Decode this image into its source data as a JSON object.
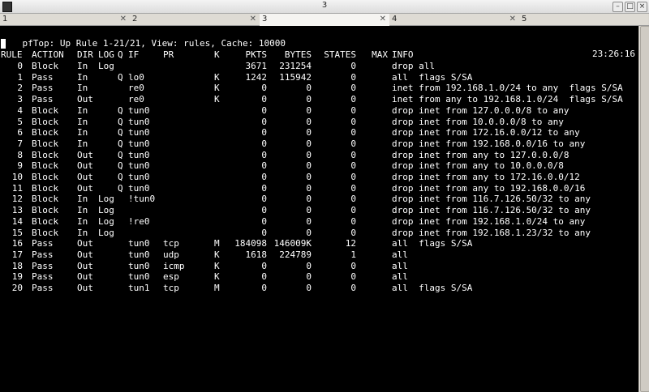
{
  "window": {
    "title": "3"
  },
  "tabs": [
    {
      "label": "1"
    },
    {
      "label": "2"
    },
    {
      "label": "3"
    },
    {
      "label": "4"
    },
    {
      "label": "5"
    }
  ],
  "status": {
    "left": "pfTop: Up Rule 1-21/21, View: rules, Cache: 10000",
    "clock": "23:26:16"
  },
  "headers": {
    "rule": "RULE",
    "action": "ACTION",
    "dir": "DIR",
    "log": "LOG",
    "q": "Q",
    "if": "IF",
    "pr": "PR",
    "k": "K",
    "pkts": "PKTS",
    "bytes": "BYTES",
    "states": "STATES",
    "max": "MAX",
    "info": "INFO"
  },
  "rows": [
    {
      "rule": "0",
      "action": "Block",
      "dir": "In",
      "log": "Log",
      "q": "",
      "if": "",
      "pr": "",
      "k": "",
      "pkts": "3671",
      "bytes": "231254",
      "states": "0",
      "max": "",
      "info": "drop all"
    },
    {
      "rule": "1",
      "action": "Pass",
      "dir": "In",
      "log": "",
      "q": "Q",
      "if": "lo0",
      "pr": "",
      "k": "K",
      "pkts": "1242",
      "bytes": "115942",
      "states": "0",
      "max": "",
      "info": "all  flags S/SA"
    },
    {
      "rule": "2",
      "action": "Pass",
      "dir": "In",
      "log": "",
      "q": "",
      "if": "re0",
      "pr": "",
      "k": "K",
      "pkts": "0",
      "bytes": "0",
      "states": "0",
      "max": "",
      "info": "inet from 192.168.1.0/24 to any  flags S/SA"
    },
    {
      "rule": "3",
      "action": "Pass",
      "dir": "Out",
      "log": "",
      "q": "",
      "if": "re0",
      "pr": "",
      "k": "K",
      "pkts": "0",
      "bytes": "0",
      "states": "0",
      "max": "",
      "info": "inet from any to 192.168.1.0/24  flags S/SA"
    },
    {
      "rule": "4",
      "action": "Block",
      "dir": "In",
      "log": "",
      "q": "Q",
      "if": "tun0",
      "pr": "",
      "k": "",
      "pkts": "0",
      "bytes": "0",
      "states": "0",
      "max": "",
      "info": "drop inet from 127.0.0.0/8 to any"
    },
    {
      "rule": "5",
      "action": "Block",
      "dir": "In",
      "log": "",
      "q": "Q",
      "if": "tun0",
      "pr": "",
      "k": "",
      "pkts": "0",
      "bytes": "0",
      "states": "0",
      "max": "",
      "info": "drop inet from 10.0.0.0/8 to any"
    },
    {
      "rule": "6",
      "action": "Block",
      "dir": "In",
      "log": "",
      "q": "Q",
      "if": "tun0",
      "pr": "",
      "k": "",
      "pkts": "0",
      "bytes": "0",
      "states": "0",
      "max": "",
      "info": "drop inet from 172.16.0.0/12 to any"
    },
    {
      "rule": "7",
      "action": "Block",
      "dir": "In",
      "log": "",
      "q": "Q",
      "if": "tun0",
      "pr": "",
      "k": "",
      "pkts": "0",
      "bytes": "0",
      "states": "0",
      "max": "",
      "info": "drop inet from 192.168.0.0/16 to any"
    },
    {
      "rule": "8",
      "action": "Block",
      "dir": "Out",
      "log": "",
      "q": "Q",
      "if": "tun0",
      "pr": "",
      "k": "",
      "pkts": "0",
      "bytes": "0",
      "states": "0",
      "max": "",
      "info": "drop inet from any to 127.0.0.0/8"
    },
    {
      "rule": "9",
      "action": "Block",
      "dir": "Out",
      "log": "",
      "q": "Q",
      "if": "tun0",
      "pr": "",
      "k": "",
      "pkts": "0",
      "bytes": "0",
      "states": "0",
      "max": "",
      "info": "drop inet from any to 10.0.0.0/8"
    },
    {
      "rule": "10",
      "action": "Block",
      "dir": "Out",
      "log": "",
      "q": "Q",
      "if": "tun0",
      "pr": "",
      "k": "",
      "pkts": "0",
      "bytes": "0",
      "states": "0",
      "max": "",
      "info": "drop inet from any to 172.16.0.0/12"
    },
    {
      "rule": "11",
      "action": "Block",
      "dir": "Out",
      "log": "",
      "q": "Q",
      "if": "tun0",
      "pr": "",
      "k": "",
      "pkts": "0",
      "bytes": "0",
      "states": "0",
      "max": "",
      "info": "drop inet from any to 192.168.0.0/16"
    },
    {
      "rule": "12",
      "action": "Block",
      "dir": "In",
      "log": "Log",
      "q": "",
      "if": "!tun0",
      "pr": "",
      "k": "",
      "pkts": "0",
      "bytes": "0",
      "states": "0",
      "max": "",
      "info": "drop inet from 116.7.126.50/32 to any"
    },
    {
      "rule": "13",
      "action": "Block",
      "dir": "In",
      "log": "Log",
      "q": "",
      "if": "",
      "pr": "",
      "k": "",
      "pkts": "0",
      "bytes": "0",
      "states": "0",
      "max": "",
      "info": "drop inet from 116.7.126.50/32 to any"
    },
    {
      "rule": "14",
      "action": "Block",
      "dir": "In",
      "log": "Log",
      "q": "",
      "if": "!re0",
      "pr": "",
      "k": "",
      "pkts": "0",
      "bytes": "0",
      "states": "0",
      "max": "",
      "info": "drop inet from 192.168.1.0/24 to any"
    },
    {
      "rule": "15",
      "action": "Block",
      "dir": "In",
      "log": "Log",
      "q": "",
      "if": "",
      "pr": "",
      "k": "",
      "pkts": "0",
      "bytes": "0",
      "states": "0",
      "max": "",
      "info": "drop inet from 192.168.1.23/32 to any"
    },
    {
      "rule": "16",
      "action": "Pass",
      "dir": "Out",
      "log": "",
      "q": "",
      "if": "tun0",
      "pr": "tcp",
      "k": "M",
      "pkts": "184098",
      "bytes": "146009K",
      "states": "12",
      "max": "",
      "info": "all  flags S/SA"
    },
    {
      "rule": "17",
      "action": "Pass",
      "dir": "Out",
      "log": "",
      "q": "",
      "if": "tun0",
      "pr": "udp",
      "k": "K",
      "pkts": "1618",
      "bytes": "224789",
      "states": "1",
      "max": "",
      "info": "all"
    },
    {
      "rule": "18",
      "action": "Pass",
      "dir": "Out",
      "log": "",
      "q": "",
      "if": "tun0",
      "pr": "icmp",
      "k": "K",
      "pkts": "0",
      "bytes": "0",
      "states": "0",
      "max": "",
      "info": "all"
    },
    {
      "rule": "19",
      "action": "Pass",
      "dir": "Out",
      "log": "",
      "q": "",
      "if": "tun0",
      "pr": "esp",
      "k": "K",
      "pkts": "0",
      "bytes": "0",
      "states": "0",
      "max": "",
      "info": "all"
    },
    {
      "rule": "20",
      "action": "Pass",
      "dir": "Out",
      "log": "",
      "q": "",
      "if": "tun1",
      "pr": "tcp",
      "k": "M",
      "pkts": "0",
      "bytes": "0",
      "states": "0",
      "max": "",
      "info": "all  flags S/SA"
    }
  ]
}
